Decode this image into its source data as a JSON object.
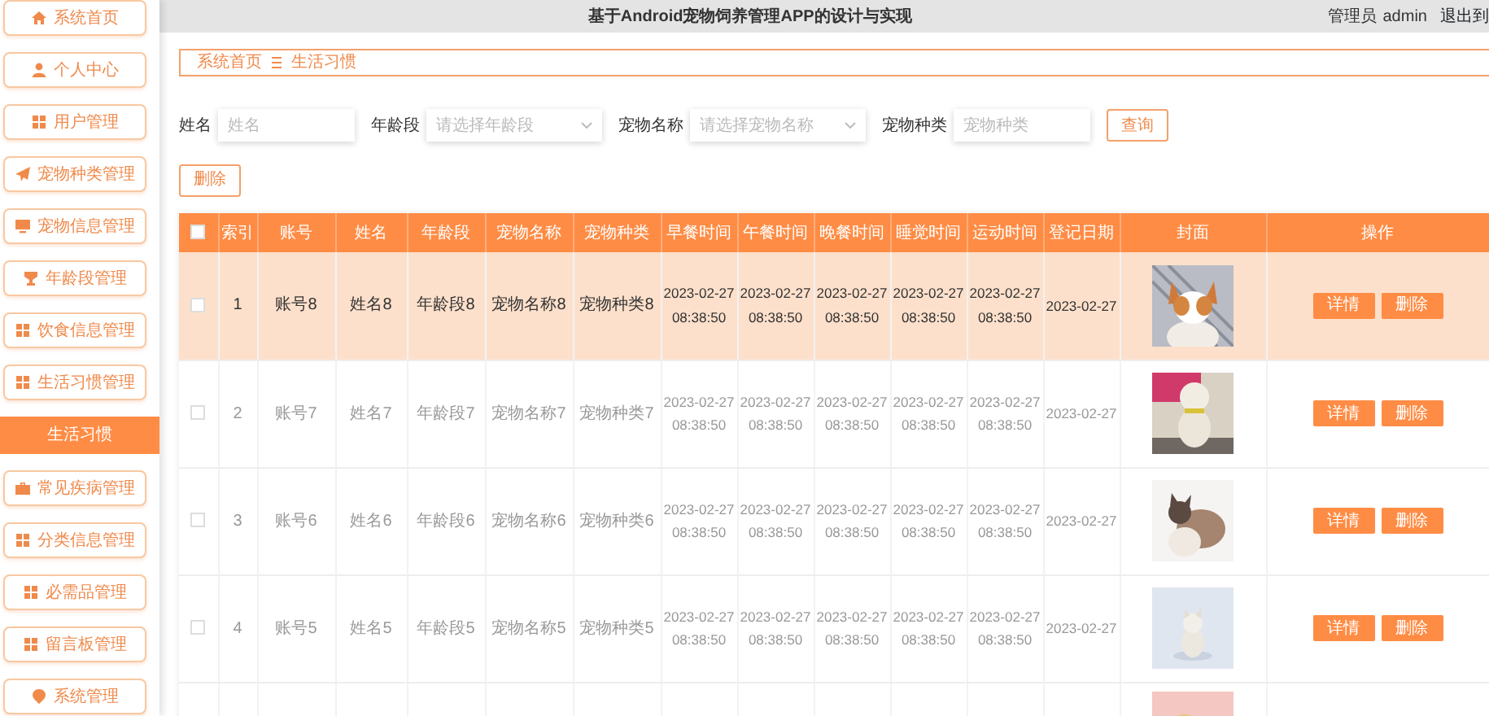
{
  "header": {
    "title": "基于Android宠物饲养管理APP的设计与实现",
    "user_role": "管理员",
    "username": "admin",
    "logout": "退出到"
  },
  "sidebar": {
    "items": [
      {
        "label": "系统首页",
        "kind": "menu",
        "selected": false
      },
      {
        "label": "个人中心",
        "kind": "menu",
        "selected": false
      },
      {
        "label": "用户管理",
        "kind": "menu",
        "selected": false
      },
      {
        "label": "宠物种类管理",
        "kind": "menu",
        "selected": false
      },
      {
        "label": "宠物信息管理",
        "kind": "menu",
        "selected": false
      },
      {
        "label": "年龄段管理",
        "kind": "menu",
        "selected": false
      },
      {
        "label": "饮食信息管理",
        "kind": "menu",
        "selected": false
      },
      {
        "label": "生活习惯管理",
        "kind": "menu",
        "selected": false
      },
      {
        "label": "生活习惯",
        "kind": "submenu",
        "selected": true
      },
      {
        "label": "常见疾病管理",
        "kind": "menu",
        "selected": false
      },
      {
        "label": "分类信息管理",
        "kind": "menu",
        "selected": false
      },
      {
        "label": "必需品管理",
        "kind": "menu",
        "selected": false
      },
      {
        "label": "留言板管理",
        "kind": "menu",
        "selected": false
      },
      {
        "label": "系统管理",
        "kind": "menu",
        "selected": false
      }
    ]
  },
  "breadcrumb": [
    "系统首页",
    "生活习惯"
  ],
  "search": {
    "fields": [
      {
        "label": "姓名",
        "placeholder": "姓名",
        "kind": "input"
      },
      {
        "label": "年龄段",
        "placeholder": "请选择年龄段",
        "kind": "select"
      },
      {
        "label": "宠物名称",
        "placeholder": "请选择宠物名称",
        "kind": "select"
      },
      {
        "label": "宠物种类",
        "placeholder": "宠物种类",
        "kind": "input"
      }
    ],
    "button": "查询"
  },
  "delete_button": "删除",
  "table": {
    "header_checked": false,
    "columns": [
      "索引",
      "账号",
      "姓名",
      "年龄段",
      "宠物名称",
      "宠物种类",
      "早餐时间",
      "午餐时间",
      "晚餐时间",
      "睡觉时间",
      "运动时间",
      "登记日期",
      "封面",
      "操作"
    ],
    "rows": [
      {
        "checked": false,
        "selected": true,
        "cells": [
          "1",
          "账号8",
          "姓名8",
          "年龄段8",
          "宠物名称8",
          "宠物种类8",
          "2023-02-27 08:38:50",
          "2023-02-27 08:38:50",
          "2023-02-27 08:38:50",
          "2023-02-27 08:38:50",
          "2023-02-27 08:38:50",
          "2023-02-27"
        ],
        "actions": [
          "详情",
          "删除"
        ]
      },
      {
        "checked": false,
        "selected": false,
        "cells": [
          "2",
          "账号7",
          "姓名7",
          "年龄段7",
          "宠物名称7",
          "宠物种类7",
          "2023-02-27 08:38:50",
          "2023-02-27 08:38:50",
          "2023-02-27 08:38:50",
          "2023-02-27 08:38:50",
          "2023-02-27 08:38:50",
          "2023-02-27"
        ],
        "actions": [
          "详情",
          "删除"
        ]
      },
      {
        "checked": false,
        "selected": false,
        "cells": [
          "3",
          "账号6",
          "姓名6",
          "年龄段6",
          "宠物名称6",
          "宠物种类6",
          "2023-02-27 08:38:50",
          "2023-02-27 08:38:50",
          "2023-02-27 08:38:50",
          "2023-02-27 08:38:50",
          "2023-02-27 08:38:50",
          "2023-02-27"
        ],
        "actions": [
          "详情",
          "删除"
        ]
      },
      {
        "checked": false,
        "selected": false,
        "cells": [
          "4",
          "账号5",
          "姓名5",
          "年龄段5",
          "宠物名称5",
          "宠物种类5",
          "2023-02-27 08:38:50",
          "2023-02-27 08:38:50",
          "2023-02-27 08:38:50",
          "2023-02-27 08:38:50",
          "2023-02-27 08:38:50",
          "2023-02-27"
        ],
        "actions": [
          "详情",
          "删除"
        ]
      }
    ]
  }
}
